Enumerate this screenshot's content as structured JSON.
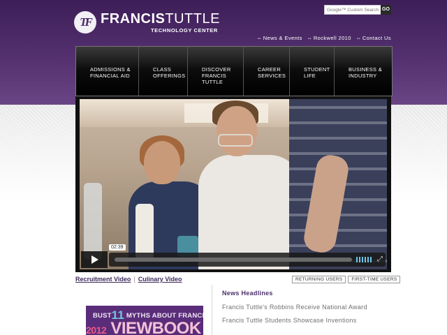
{
  "brand": {
    "logo_mark": "TF",
    "name_bold": "FRANCIS",
    "name_light": "TUTTLE",
    "subtitle": "TECHNOLOGY CENTER",
    "primary_color": "#4b2f6b"
  },
  "search": {
    "placeholder": "Google™ Custom Search",
    "button_label": "GO"
  },
  "utility_links": [
    {
      "label": "News & Events"
    },
    {
      "label": "Rockwell 2010"
    },
    {
      "label": "Contact Us"
    }
  ],
  "nav": {
    "items": [
      {
        "label": "ADMISSIONS &\nFINANCIAL AID"
      },
      {
        "label": "CLASS\nOFFERINGS"
      },
      {
        "label": "DISCOVER\nFRANCIS TUTTLE"
      },
      {
        "label": "CAREER\nSERVICES"
      },
      {
        "label": "STUDENT\nLIFE"
      },
      {
        "label": "BUSINESS &\nINDUSTRY"
      }
    ]
  },
  "video": {
    "time": "02:39",
    "progress": 0.0,
    "icons": [
      "play-icon",
      "volume-icon",
      "fullscreen-icon"
    ]
  },
  "video_links": {
    "recruitment": "Recruitment Video",
    "separator": "|",
    "culinary": "Culinary Video"
  },
  "user_tabs": {
    "returning": "RETURNING USERS",
    "first_time": "FIRST-TIME USERS"
  },
  "viewbook": {
    "prefix": "BUST",
    "number": "11",
    "tagline": "MYTHS ABOUT FRANCIS TUTTLE HERE",
    "year": "2012",
    "title": "VIEWBOOK"
  },
  "news": {
    "heading": "News Headlines",
    "items": [
      {
        "title": "Francis Tuttle's Robbins Receive National Award"
      },
      {
        "title": "Francis Tuttle Students Showcase Inventions"
      }
    ]
  }
}
